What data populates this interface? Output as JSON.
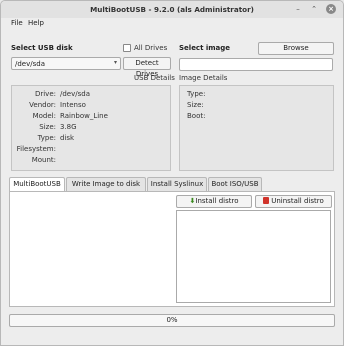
{
  "window": {
    "title": "MultiBootUSB - 9.2.0 (als Administrator)",
    "controls": {
      "minimize": "–",
      "maximize": "⌃",
      "close": "×"
    }
  },
  "menu": {
    "file": "File",
    "help": "Help"
  },
  "usb": {
    "select_label": "Select USB disk",
    "all_drives_label": "All Drives",
    "all_drives_checked": false,
    "selected_disk": "/dev/sda",
    "detect_button": "Detect Drives",
    "details_title": "USB Details",
    "details": [
      {
        "key": "Drive:",
        "value": "/dev/sda"
      },
      {
        "key": "Vendor:",
        "value": "Intenso"
      },
      {
        "key": "Model:",
        "value": "Rainbow_Line"
      },
      {
        "key": "Size:",
        "value": "3.8G"
      },
      {
        "key": "Type:",
        "value": "disk"
      },
      {
        "key": "Filesystem:",
        "value": ""
      },
      {
        "key": "Mount:",
        "value": ""
      }
    ]
  },
  "image": {
    "select_label": "Select image",
    "browse_button": "Browse",
    "path_value": "",
    "details_title": "Image Details",
    "details": [
      {
        "key": "Type:",
        "value": ""
      },
      {
        "key": "Size:",
        "value": ""
      },
      {
        "key": "Boot:",
        "value": ""
      }
    ]
  },
  "tabs": [
    {
      "label": "MultiBootUSB",
      "active": true
    },
    {
      "label": "Write Image to disk",
      "active": false
    },
    {
      "label": "Install Syslinux",
      "active": false
    },
    {
      "label": "Boot ISO/USB",
      "active": false
    }
  ],
  "multiboot": {
    "install_button": "Install distro",
    "uninstall_button": "Uninstall distro"
  },
  "progress": {
    "value": 0,
    "text": "0%"
  },
  "colors": {
    "install_icon": "#3a8a1e",
    "uninstall_icon": "#d0332b"
  },
  "icons": {
    "install": "download-arrow-icon",
    "uninstall": "trash-icon"
  }
}
